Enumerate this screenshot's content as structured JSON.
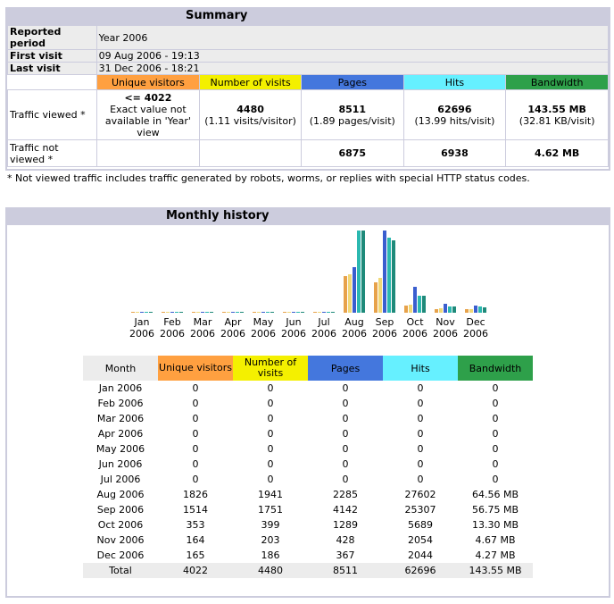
{
  "summary": {
    "title": "Summary",
    "reported_period_label": "Reported period",
    "reported_period_value": "Year 2006",
    "first_visit_label": "First visit",
    "first_visit_value": "09 Aug 2006 - 19:13",
    "last_visit_label": "Last visit",
    "last_visit_value": "31 Dec 2006 - 18:21",
    "columns": [
      "Unique visitors",
      "Number of visits",
      "Pages",
      "Hits",
      "Bandwidth"
    ],
    "viewed_label": "Traffic viewed *",
    "viewed": {
      "uv_main": "<= 4022",
      "uv_sub": "Exact value not available in 'Year' view",
      "visits_main": "4480",
      "visits_sub": "(1.11 visits/visitor)",
      "pages_main": "8511",
      "pages_sub": "(1.89 pages/visit)",
      "hits_main": "62696",
      "hits_sub": "(13.99 hits/visit)",
      "bw_main": "143.55 MB",
      "bw_sub": "(32.81 KB/visit)"
    },
    "not_viewed_label": "Traffic not viewed *",
    "not_viewed": {
      "pages": "6875",
      "hits": "6938",
      "bw": "4.62 MB"
    },
    "footnote": "* Not viewed traffic includes traffic generated by robots, worms, or replies with special HTTP status codes."
  },
  "monthly": {
    "title": "Monthly history",
    "columns": [
      "Month",
      "Unique visitors",
      "Number of visits",
      "Pages",
      "Hits",
      "Bandwidth"
    ],
    "rows": [
      {
        "month": "Jan 2006",
        "uv": "0",
        "visits": "0",
        "pages": "0",
        "hits": "0",
        "bw": "0"
      },
      {
        "month": "Feb 2006",
        "uv": "0",
        "visits": "0",
        "pages": "0",
        "hits": "0",
        "bw": "0"
      },
      {
        "month": "Mar 2006",
        "uv": "0",
        "visits": "0",
        "pages": "0",
        "hits": "0",
        "bw": "0"
      },
      {
        "month": "Apr 2006",
        "uv": "0",
        "visits": "0",
        "pages": "0",
        "hits": "0",
        "bw": "0"
      },
      {
        "month": "May 2006",
        "uv": "0",
        "visits": "0",
        "pages": "0",
        "hits": "0",
        "bw": "0"
      },
      {
        "month": "Jun 2006",
        "uv": "0",
        "visits": "0",
        "pages": "0",
        "hits": "0",
        "bw": "0"
      },
      {
        "month": "Jul 2006",
        "uv": "0",
        "visits": "0",
        "pages": "0",
        "hits": "0",
        "bw": "0"
      },
      {
        "month": "Aug 2006",
        "uv": "1826",
        "visits": "1941",
        "pages": "2285",
        "hits": "27602",
        "bw": "64.56 MB"
      },
      {
        "month": "Sep 2006",
        "uv": "1514",
        "visits": "1751",
        "pages": "4142",
        "hits": "25307",
        "bw": "56.75 MB"
      },
      {
        "month": "Oct 2006",
        "uv": "353",
        "visits": "399",
        "pages": "1289",
        "hits": "5689",
        "bw": "13.30 MB"
      },
      {
        "month": "Nov 2006",
        "uv": "164",
        "visits": "203",
        "pages": "428",
        "hits": "2054",
        "bw": "4.67 MB"
      },
      {
        "month": "Dec 2006",
        "uv": "165",
        "visits": "186",
        "pages": "367",
        "hits": "2044",
        "bw": "4.27 MB"
      }
    ],
    "total": {
      "month": "Total",
      "uv": "4022",
      "visits": "4480",
      "pages": "8511",
      "hits": "62696",
      "bw": "143.55 MB"
    }
  },
  "chart_data": {
    "type": "bar",
    "categories": [
      [
        "Jan",
        "2006"
      ],
      [
        "Feb",
        "2006"
      ],
      [
        "Mar",
        "2006"
      ],
      [
        "Apr",
        "2006"
      ],
      [
        "May",
        "2006"
      ],
      [
        "Jun",
        "2006"
      ],
      [
        "Jul",
        "2006"
      ],
      [
        "Aug",
        "2006"
      ],
      [
        "Sep",
        "2006"
      ],
      [
        "Oct",
        "2006"
      ],
      [
        "Nov",
        "2006"
      ],
      [
        "Dec",
        "2006"
      ]
    ],
    "series": [
      {
        "key": "uv",
        "color": "#e7a24a",
        "values": [
          0,
          0,
          0,
          0,
          0,
          0,
          0,
          1826,
          1514,
          353,
          164,
          165
        ]
      },
      {
        "key": "visits",
        "color": "#f0d878",
        "values": [
          0,
          0,
          0,
          0,
          0,
          0,
          0,
          1941,
          1751,
          399,
          203,
          186
        ]
      },
      {
        "key": "pages",
        "color": "#3a5ecf",
        "values": [
          0,
          0,
          0,
          0,
          0,
          0,
          0,
          2285,
          4142,
          1289,
          428,
          367
        ]
      },
      {
        "key": "hits",
        "color": "#2bb8b0",
        "values": [
          0,
          0,
          0,
          0,
          0,
          0,
          0,
          27602,
          25307,
          5689,
          2054,
          2044
        ]
      },
      {
        "key": "bw",
        "color": "#1e8a7a",
        "values": [
          0,
          0,
          0,
          0,
          0,
          0,
          0,
          64.56,
          56.75,
          13.3,
          4.67,
          4.27
        ]
      }
    ],
    "grid": false,
    "legend": "none"
  }
}
